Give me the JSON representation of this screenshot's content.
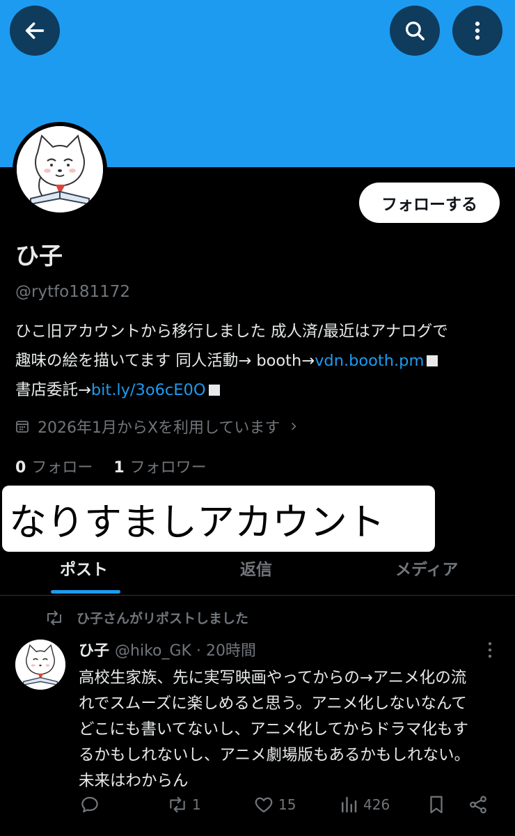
{
  "header": {
    "back_icon": "arrow-left-icon",
    "search_icon": "search-icon",
    "more_icon": "more-vertical-icon",
    "banner_color": "#1d9bf0"
  },
  "profile": {
    "name": "ひ子",
    "handle": "@rytfo181172",
    "follow_label": "フォローする",
    "bio_line1": "ひこ旧アカウントから移行しました 成人済/最近はアナログで",
    "bio_line2_prefix": "趣味の絵を描いてます 同人活動→ booth→",
    "bio_link1": "vdn.booth.pm",
    "bio_line3_prefix": "書店委託→",
    "bio_link2": "bit.ly/3o6cE0O",
    "joined": "2026年1月からXを利用しています",
    "following_count": "0",
    "following_label": "フォロー",
    "followers_count": "1",
    "followers_label": "フォロワー"
  },
  "overlay_caption": "なりすましアカウント",
  "tabs": [
    {
      "label": "ポスト",
      "active": true
    },
    {
      "label": "返信",
      "active": false
    },
    {
      "label": "メディア",
      "active": false
    }
  ],
  "post": {
    "repost_text": "ひ子さんがリポストしました",
    "author_name": "ひ子",
    "author_meta": "@hiko_GK · 20時間",
    "text_lines": [
      "高校生家族、先に実写映画やってからの→アニメ化の流",
      "れでスムーズに楽しめると思う。アニメ化しないなんて",
      "どこにも書いてないし、アニメ化してからドラマ化もす",
      "るかもしれないし、アニメ劇場版もあるかもしれない。",
      "未来はわからん"
    ],
    "reposts": "1",
    "likes": "15",
    "views": "426"
  }
}
